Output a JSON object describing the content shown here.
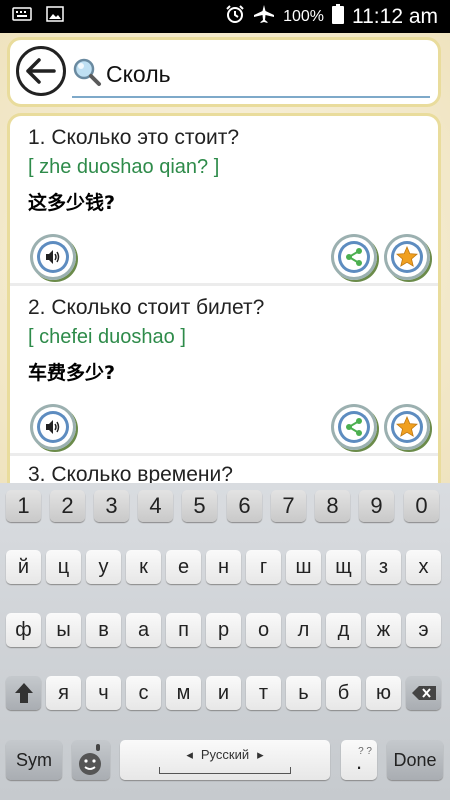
{
  "status_bar": {
    "battery": "100%",
    "time": "11:12 am",
    "icons": [
      "keyboard-icon",
      "image-icon",
      "alarm-icon",
      "airplane-mode-icon",
      "battery-icon"
    ]
  },
  "search": {
    "value": "Сколь",
    "icon": "magnifier-icon"
  },
  "phrases": [
    {
      "ru": "1. Сколько это стоит?",
      "pinyin": "[ zhe duoshao qian? ]",
      "cn": "这多少钱?"
    },
    {
      "ru": "2. Сколько стоит билет?",
      "pinyin": "[ chefei duoshao ]",
      "cn": "车费多少?"
    }
  ],
  "partial_item": "3. Сколько времени?",
  "keyboard": {
    "numbers": [
      "1",
      "2",
      "3",
      "4",
      "5",
      "6",
      "7",
      "8",
      "9",
      "0"
    ],
    "row1": [
      "й",
      "ц",
      "у",
      "к",
      "е",
      "н",
      "г",
      "ш",
      "щ",
      "з",
      "х"
    ],
    "row2": [
      "ф",
      "ы",
      "в",
      "а",
      "п",
      "р",
      "о",
      "л",
      "д",
      "ж",
      "э"
    ],
    "row3": [
      "я",
      "ч",
      "с",
      "м",
      "и",
      "т",
      "ь",
      "б",
      "ю"
    ],
    "sym": "Sym",
    "language": "Русский",
    "period": ".",
    "period_hint": "? ?",
    "done": "Done"
  },
  "colors": {
    "pinyin": "#2e8b4a",
    "card_border": "#e9dc9c",
    "star": "#f0a020"
  }
}
